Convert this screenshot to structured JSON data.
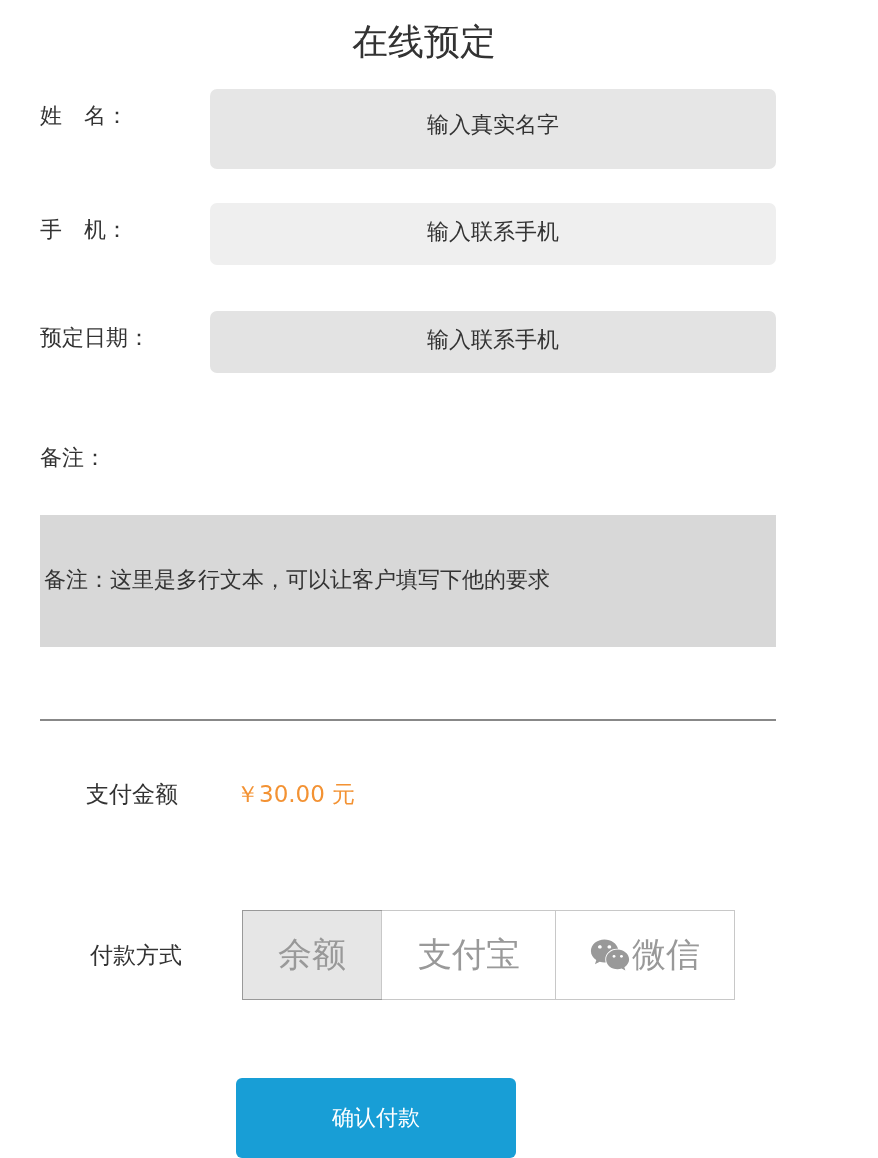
{
  "title": "在线预定",
  "fields": [
    {
      "label": "姓　名：",
      "placeholder": "输入真实名字"
    },
    {
      "label": "手　机：",
      "placeholder": "输入联系手机"
    },
    {
      "label": "预定日期：",
      "placeholder": "输入联系手机"
    }
  ],
  "remark": {
    "label": "备注：",
    "placeholder": "备注：这里是多行文本，可以让客户填写下他的要求"
  },
  "amount": {
    "label": "支付金额",
    "value": "￥30.00 元"
  },
  "payment": {
    "label": "付款方式",
    "methods": [
      {
        "kind": "balance",
        "label": "余额",
        "selected": true
      },
      {
        "kind": "alipay",
        "label": "支付宝",
        "selected": false
      },
      {
        "kind": "wechat",
        "label": "微信",
        "selected": false
      }
    ]
  },
  "submit": "确认付款"
}
